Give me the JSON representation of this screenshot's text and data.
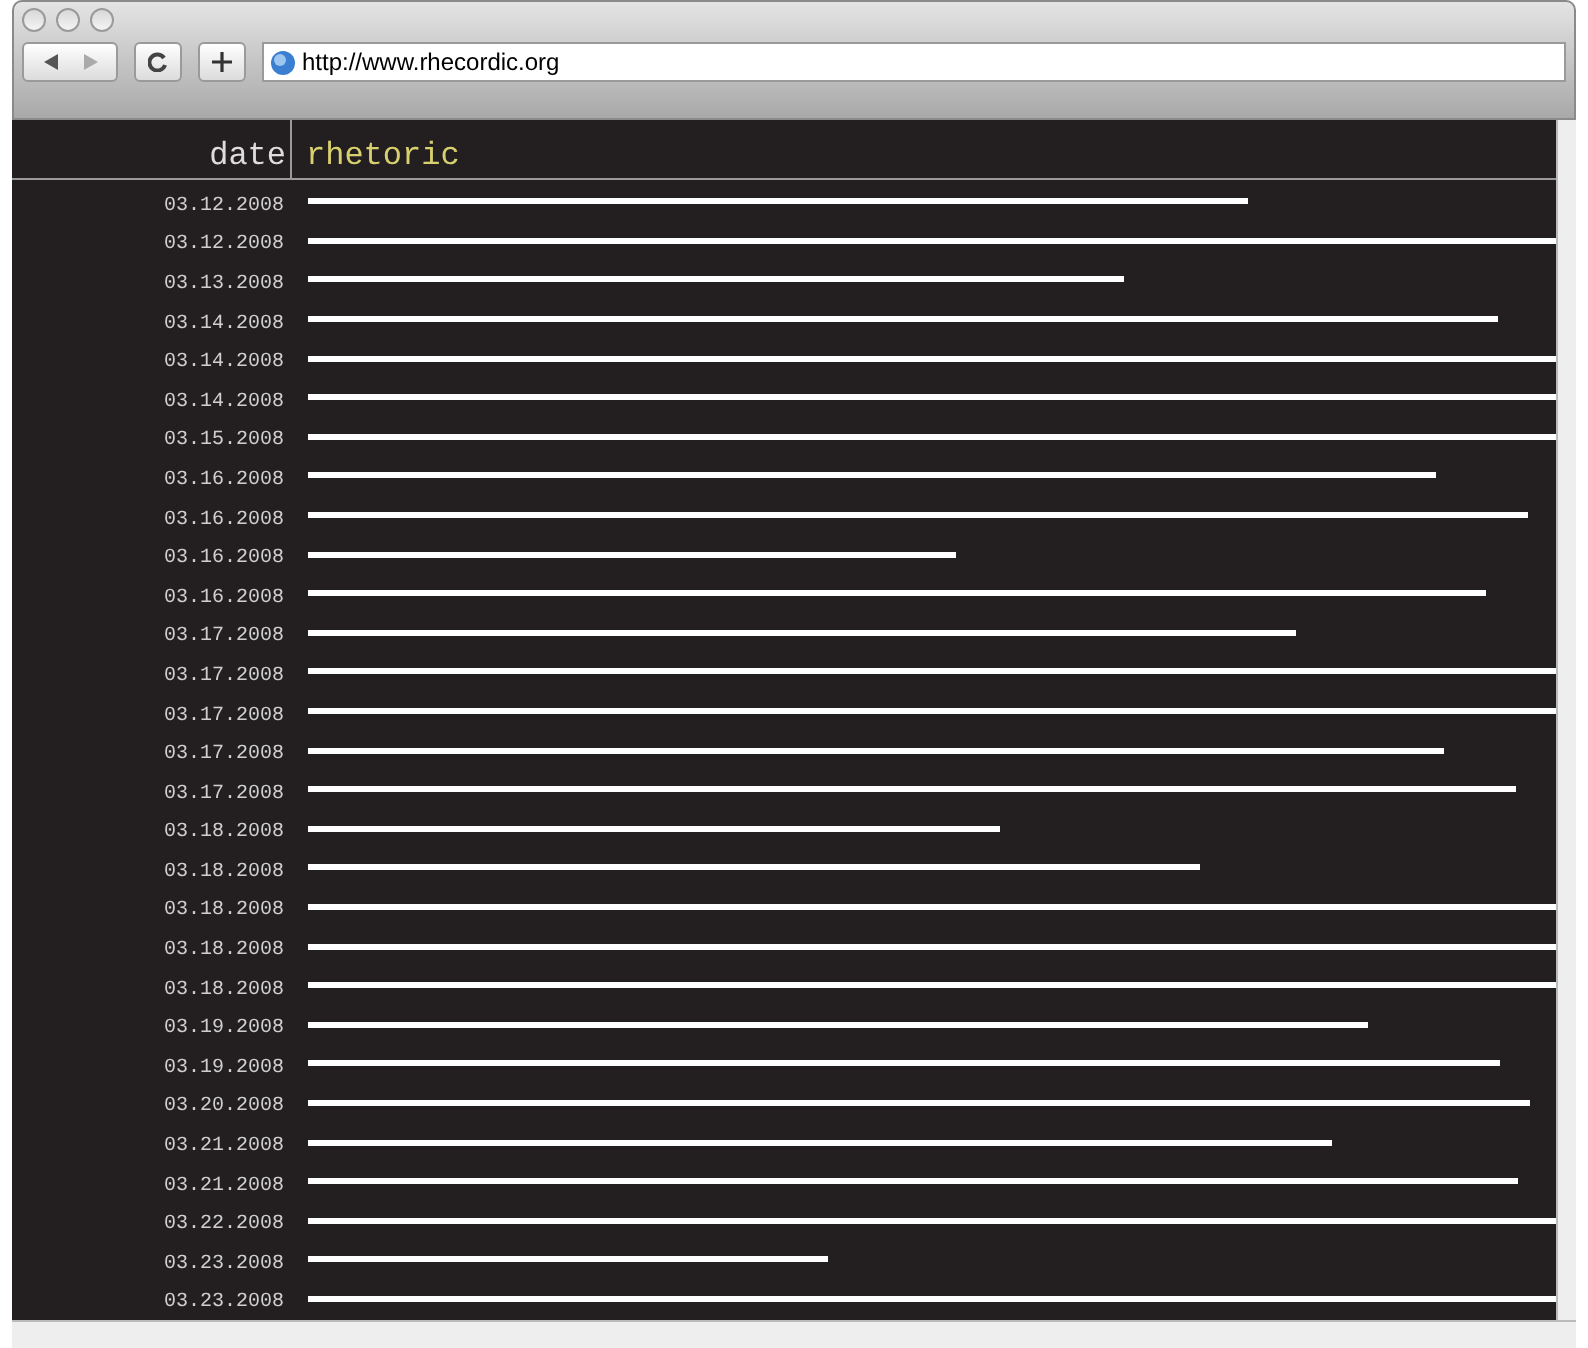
{
  "toolbar": {
    "url": "http://www.rhecordic.org"
  },
  "table": {
    "columns": [
      "date",
      "rhetoric"
    ],
    "rows": [
      {
        "date": "03.12.2008"
      },
      {
        "date": "03.12.2008"
      },
      {
        "date": "03.13.2008"
      },
      {
        "date": "03.14.2008"
      },
      {
        "date": "03.14.2008"
      },
      {
        "date": "03.14.2008"
      },
      {
        "date": "03.15.2008"
      },
      {
        "date": "03.16.2008"
      },
      {
        "date": "03.16.2008"
      },
      {
        "date": "03.16.2008"
      },
      {
        "date": "03.16.2008"
      },
      {
        "date": "03.17.2008"
      },
      {
        "date": "03.17.2008"
      },
      {
        "date": "03.17.2008"
      },
      {
        "date": "03.17.2008"
      },
      {
        "date": "03.17.2008"
      },
      {
        "date": "03.18.2008"
      },
      {
        "date": "03.18.2008"
      },
      {
        "date": "03.18.2008"
      },
      {
        "date": "03.18.2008"
      },
      {
        "date": "03.18.2008"
      },
      {
        "date": "03.19.2008"
      },
      {
        "date": "03.19.2008"
      },
      {
        "date": "03.20.2008"
      },
      {
        "date": "03.21.2008"
      },
      {
        "date": "03.21.2008"
      },
      {
        "date": "03.22.2008"
      },
      {
        "date": "03.23.2008"
      },
      {
        "date": "03.23.2008"
      }
    ]
  }
}
